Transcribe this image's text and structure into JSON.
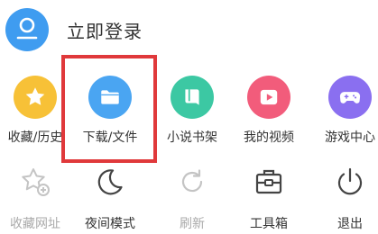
{
  "header": {
    "login_label": "立即登录",
    "avatar_icon": "user-avatar-icon"
  },
  "row1": [
    {
      "label": "收藏/历史",
      "icon": "star-icon",
      "color": "#f7c137"
    },
    {
      "label": "下载/文件",
      "icon": "folder-icon",
      "color": "#4aa5f2"
    },
    {
      "label": "小说书架",
      "icon": "book-icon",
      "color": "#3cc8a3"
    },
    {
      "label": "我的视频",
      "icon": "play-icon",
      "color": "#f25c7b"
    },
    {
      "label": "游戏中心",
      "icon": "gamepad-icon",
      "color": "#8a6ff0"
    }
  ],
  "row2": [
    {
      "label": "收藏网址",
      "icon": "star-plus-icon",
      "enabled": false
    },
    {
      "label": "夜间模式",
      "icon": "moon-icon",
      "enabled": true
    },
    {
      "label": "刷新",
      "icon": "refresh-icon",
      "enabled": false
    },
    {
      "label": "工具箱",
      "icon": "toolbox-icon",
      "enabled": true
    },
    {
      "label": "退出",
      "icon": "power-icon",
      "enabled": true
    }
  ],
  "highlight_color": "#e0393b"
}
